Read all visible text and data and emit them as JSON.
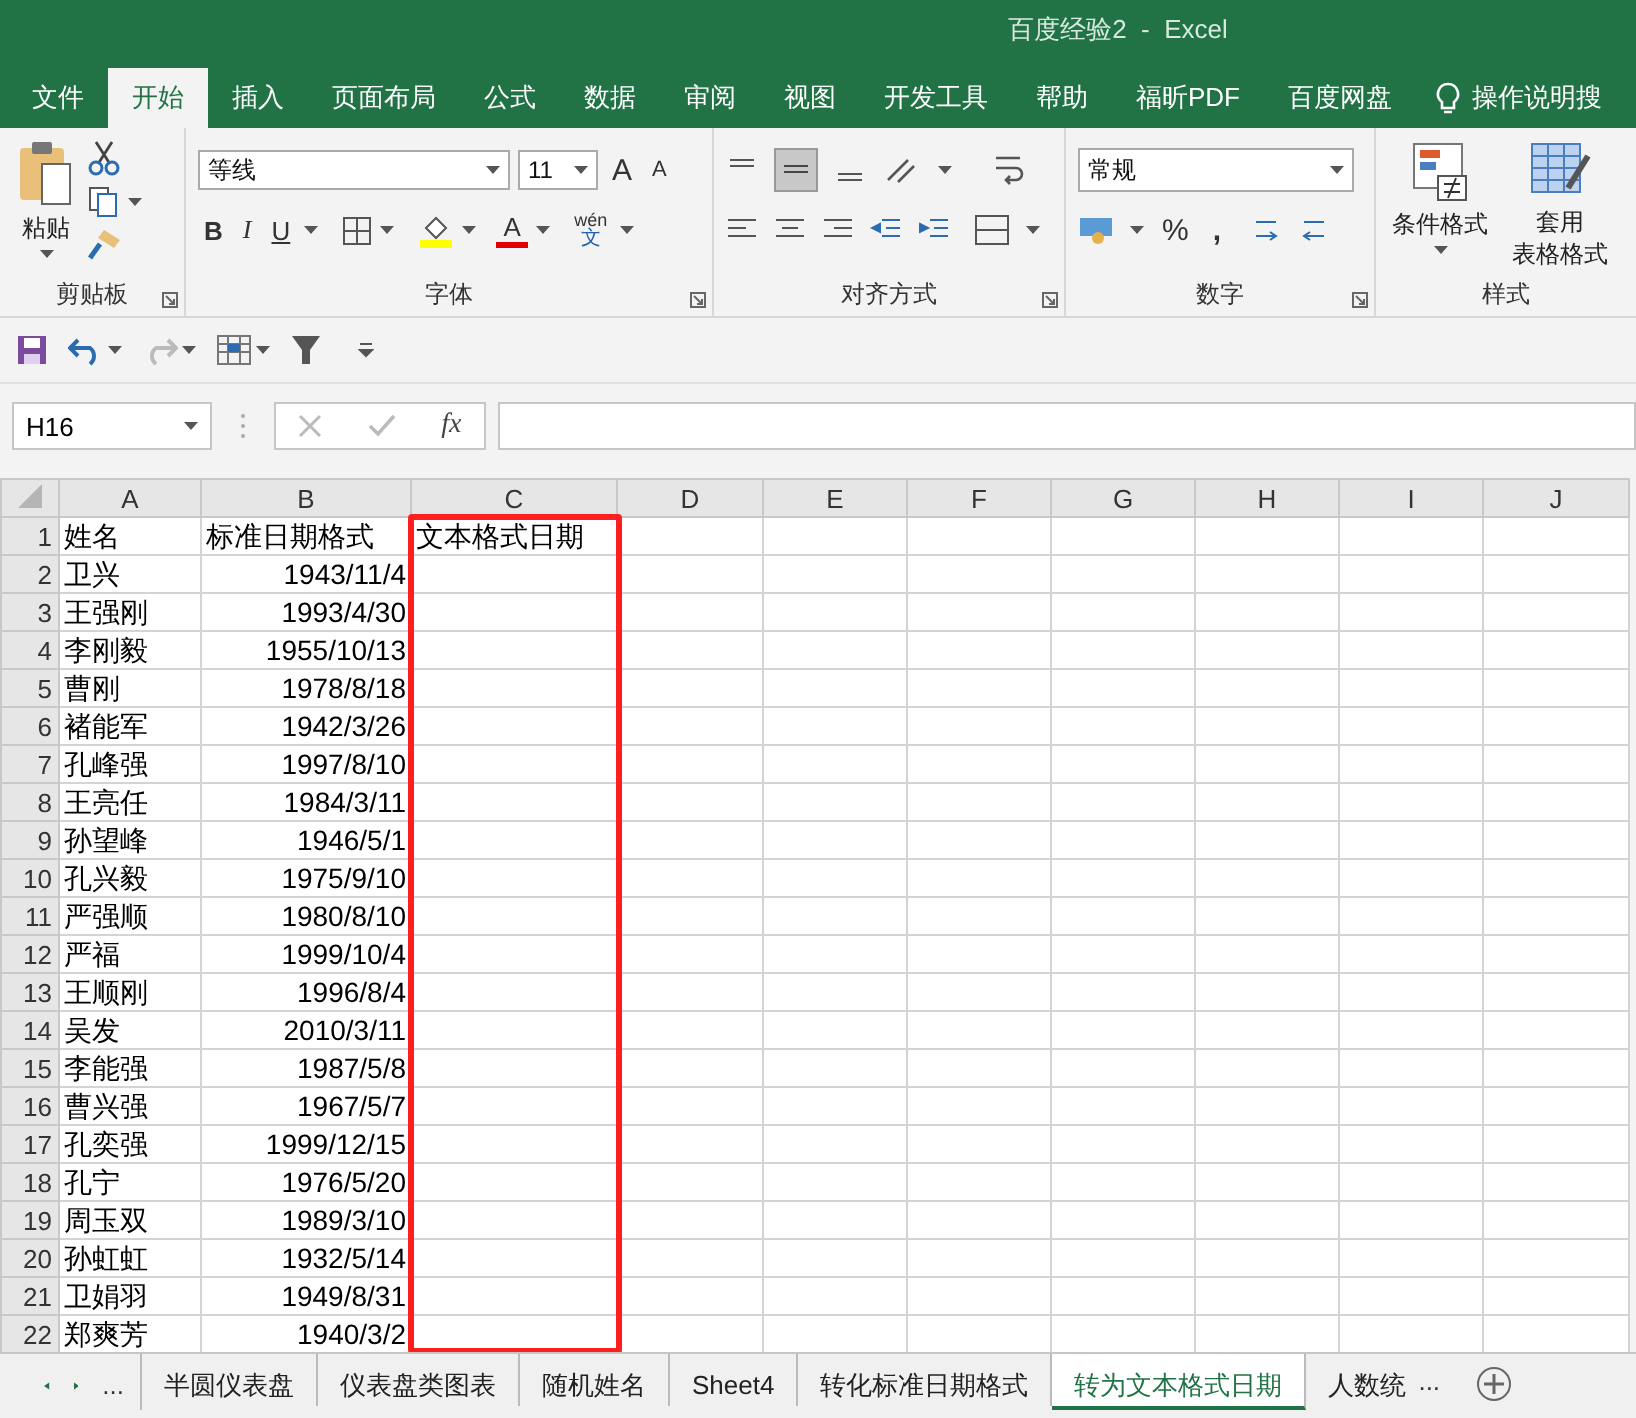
{
  "window": {
    "title": "百度经验2  -  Excel"
  },
  "ribbon_tabs": [
    {
      "label": "文件",
      "selected": false
    },
    {
      "label": "开始",
      "selected": true
    },
    {
      "label": "插入",
      "selected": false
    },
    {
      "label": "页面布局",
      "selected": false
    },
    {
      "label": "公式",
      "selected": false
    },
    {
      "label": "数据",
      "selected": false
    },
    {
      "label": "审阅",
      "selected": false
    },
    {
      "label": "视图",
      "selected": false
    },
    {
      "label": "开发工具",
      "selected": false
    },
    {
      "label": "帮助",
      "selected": false
    },
    {
      "label": "福昕PDF",
      "selected": false
    },
    {
      "label": "百度网盘",
      "selected": false
    }
  ],
  "tell_me": "操作说明搜",
  "ribbon": {
    "clipboard": {
      "paste": "粘贴",
      "label": "剪贴板"
    },
    "font": {
      "name": "等线",
      "size": "11",
      "bold": "B",
      "italic": "I",
      "underline": "U",
      "grow": "A",
      "shrink": "A",
      "color_letter": "A",
      "phonetic": "wén",
      "phonetic_char": "文",
      "label": "字体"
    },
    "alignment": {
      "label": "对齐方式"
    },
    "number": {
      "format": "常规",
      "percent": "%",
      "comma": ",",
      "label": "数字"
    },
    "styles": {
      "conditional": "条件格式",
      "table_lines": [
        "套用",
        "表格格式"
      ],
      "label": "样式"
    }
  },
  "name_box": "H16",
  "formula_fx": "fx",
  "columns": [
    {
      "label": "A",
      "highlighted": false
    },
    {
      "label": "B",
      "highlighted": false
    },
    {
      "label": "C",
      "highlighted": true
    },
    {
      "label": "D",
      "highlighted": false
    },
    {
      "label": "E",
      "highlighted": false
    },
    {
      "label": "F",
      "highlighted": false
    },
    {
      "label": "G",
      "highlighted": false
    },
    {
      "label": "H",
      "highlighted": false
    },
    {
      "label": "I",
      "highlighted": false
    },
    {
      "label": "J",
      "highlighted": false
    }
  ],
  "rows": [
    {
      "number": "1",
      "kind": "header",
      "cells": [
        "姓名",
        "标准日期格式",
        "文本格式日期"
      ]
    },
    {
      "number": "2",
      "kind": "data",
      "cells": [
        "卫兴",
        "1943/11/4"
      ]
    },
    {
      "number": "3",
      "kind": "data",
      "cells": [
        "王强刚",
        "1993/4/30"
      ]
    },
    {
      "number": "4",
      "kind": "data",
      "cells": [
        "李刚毅",
        "1955/10/13"
      ]
    },
    {
      "number": "5",
      "kind": "data",
      "cells": [
        "曹刚",
        "1978/8/18"
      ]
    },
    {
      "number": "6",
      "kind": "data",
      "cells": [
        "褚能军",
        "1942/3/26"
      ]
    },
    {
      "number": "7",
      "kind": "data",
      "cells": [
        "孔峰强",
        "1997/8/10"
      ]
    },
    {
      "number": "8",
      "kind": "data",
      "cells": [
        "王亮任",
        "1984/3/11"
      ]
    },
    {
      "number": "9",
      "kind": "data",
      "cells": [
        "孙望峰",
        "1946/5/1"
      ]
    },
    {
      "number": "10",
      "kind": "data",
      "cells": [
        "孔兴毅",
        "1975/9/10"
      ]
    },
    {
      "number": "11",
      "kind": "data",
      "cells": [
        "严强顺",
        "1980/8/10"
      ]
    },
    {
      "number": "12",
      "kind": "data",
      "cells": [
        "严福",
        "1999/10/4"
      ]
    },
    {
      "number": "13",
      "kind": "data",
      "cells": [
        "王顺刚",
        "1996/8/4"
      ]
    },
    {
      "number": "14",
      "kind": "data",
      "cells": [
        "吴发",
        "2010/3/11"
      ]
    },
    {
      "number": "15",
      "kind": "data",
      "cells": [
        "李能强",
        "1987/5/8"
      ]
    },
    {
      "number": "16",
      "kind": "data",
      "cells": [
        "曹兴强",
        "1967/5/7"
      ]
    },
    {
      "number": "17",
      "kind": "data",
      "cells": [
        "孔奕强",
        "1999/12/15"
      ]
    },
    {
      "number": "18",
      "kind": "data",
      "cells": [
        "孔宁",
        "1976/5/20"
      ]
    },
    {
      "number": "19",
      "kind": "data",
      "cells": [
        "周玉双",
        "1989/3/10"
      ]
    },
    {
      "number": "20",
      "kind": "data",
      "cells": [
        "孙虹虹",
        "1932/5/14"
      ]
    },
    {
      "number": "21",
      "kind": "data",
      "cells": [
        "卫娟羽",
        "1949/8/31"
      ]
    },
    {
      "number": "22",
      "kind": "data",
      "cells": [
        "郑爽芳",
        "1940/3/2"
      ]
    }
  ],
  "sheet_nav_more": "...",
  "sheet_tabs": [
    {
      "label": "半圆仪表盘",
      "selected": false
    },
    {
      "label": "仪表盘类图表",
      "selected": false
    },
    {
      "label": "随机姓名",
      "selected": false
    },
    {
      "label": "Sheet4",
      "selected": false
    },
    {
      "label": "转化标准日期格式",
      "selected": false
    },
    {
      "label": "转为文本格式日期",
      "selected": true
    },
    {
      "label": "人数统",
      "selected": false
    }
  ],
  "sheet_tabs_more": "..."
}
